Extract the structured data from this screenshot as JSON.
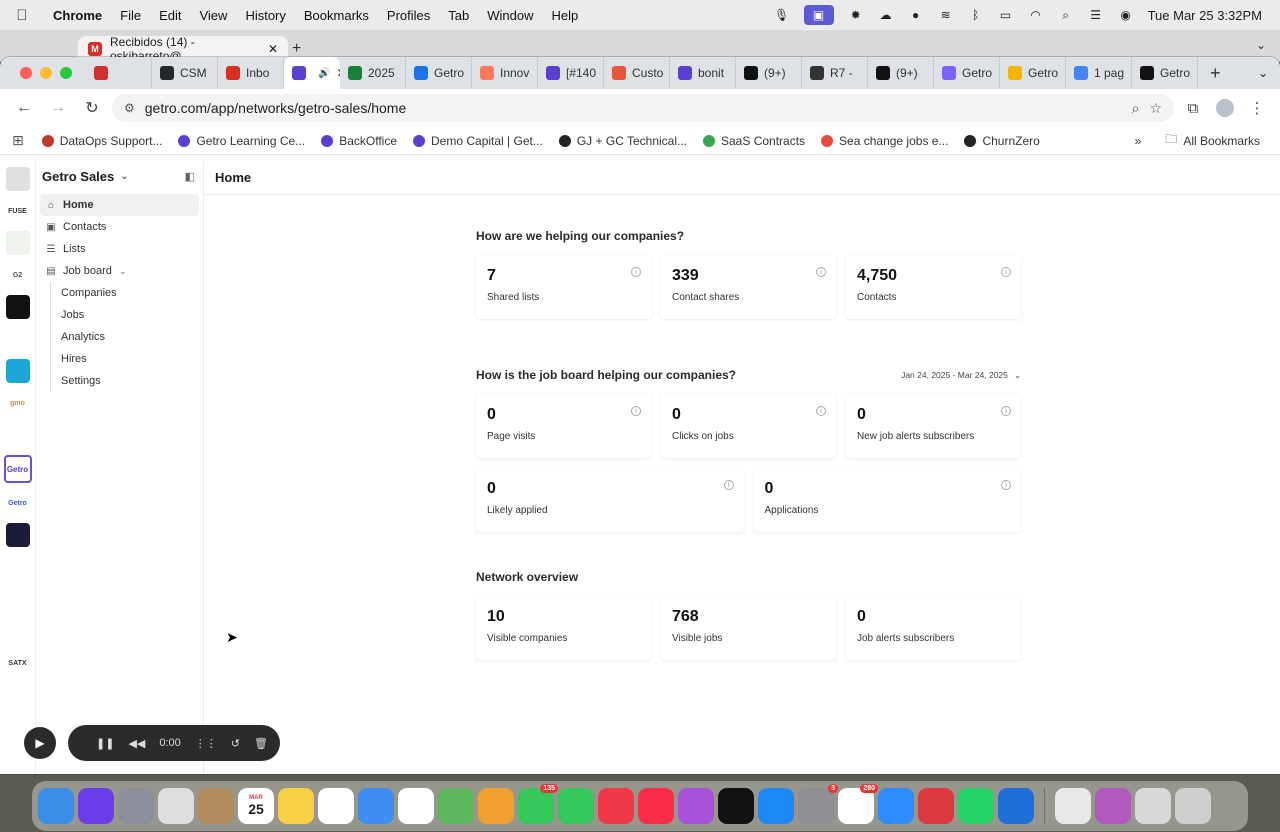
{
  "menubar": {
    "app": "Chrome",
    "items": [
      "File",
      "Edit",
      "View",
      "History",
      "Bookmarks",
      "Profiles",
      "Tab",
      "Window",
      "Help"
    ],
    "datetime": "Tue Mar 25  3:32PM"
  },
  "ghost_window": {
    "tab_title": "Recibidos (14) - oskibarreto@"
  },
  "browser": {
    "tabs": [
      {
        "label": "",
        "icon": "record-icon",
        "color": "#d32f2f"
      },
      {
        "label": "CSM",
        "icon": "github-icon",
        "color": "#24292e"
      },
      {
        "label": "Inbo",
        "icon": "gmail-icon",
        "color": "#d93025"
      },
      {
        "label": "",
        "icon": "getro-icon",
        "color": "#5b3fd0",
        "active": true
      },
      {
        "label": "2025",
        "icon": "sheets-icon",
        "color": "#188038"
      },
      {
        "label": "Getro",
        "icon": "calendar-icon",
        "color": "#1a73e8"
      },
      {
        "label": "Innov",
        "icon": "hubspot-icon",
        "color": "#ff7a59"
      },
      {
        "label": "[#140",
        "icon": "getro-icon",
        "color": "#5b3fd0"
      },
      {
        "label": "Custo",
        "icon": "zendesk-icon",
        "color": "#e8553a"
      },
      {
        "label": "bonit",
        "icon": "getro-icon",
        "color": "#5b3fd0"
      },
      {
        "label": "(9+)",
        "icon": "notion-icon",
        "color": "#111111"
      },
      {
        "label": "R7 -",
        "icon": "link-icon",
        "color": "#333333"
      },
      {
        "label": "(9+)",
        "icon": "notion-icon",
        "color": "#111111"
      },
      {
        "label": "Getro",
        "icon": "gear-icon",
        "color": "#7b61ff"
      },
      {
        "label": "Getro",
        "icon": "slides-icon",
        "color": "#f4b400"
      },
      {
        "label": "1 pag",
        "icon": "docs-icon",
        "color": "#4285f4"
      },
      {
        "label": "Getro",
        "icon": "getro-logo-icon",
        "color": "#111111"
      }
    ],
    "url": "getro.com/app/networks/getro-sales/home",
    "bookmarks": [
      {
        "label": "DataOps Support...",
        "color": "#c0392b"
      },
      {
        "label": "Getro Learning Ce...",
        "color": "#5b3fd0"
      },
      {
        "label": "BackOffice",
        "color": "#5b3fd0"
      },
      {
        "label": "Demo Capital | Get...",
        "color": "#5b3fd0"
      },
      {
        "label": "GJ + GC Technical...",
        "color": "#222222"
      },
      {
        "label": "SaaS Contracts",
        "color": "#34a853"
      },
      {
        "label": "Sea change jobs e...",
        "color": "#e74c3c"
      },
      {
        "label": "ChurnZero",
        "color": "#222222"
      }
    ],
    "all_bookmarks": "All Bookmarks"
  },
  "rail": {
    "items": [
      {
        "label": "",
        "color": "#e0e0e0",
        "text_color": "#333333"
      },
      {
        "label": "FUSE",
        "color": "#ffffff",
        "text_color": "#333333"
      },
      {
        "label": "",
        "color": "#eef3ee",
        "text_color": "#333333"
      },
      {
        "label": "G2",
        "color": "#ffffff",
        "text_color": "#555555"
      },
      {
        "label": "",
        "color": "#111111",
        "text_color": "#ffffff"
      },
      {
        "label": "",
        "color": "#ffffff",
        "text_color": "#c08a20"
      },
      {
        "label": "",
        "color": "#1aa6d6",
        "text_color": "#ffffff"
      },
      {
        "label": "gmo",
        "color": "#ffffff",
        "text_color": "#e08a1a"
      },
      {
        "label": "",
        "color": "#ffffff",
        "text_color": "#5b3fd0"
      },
      {
        "label": "Getro",
        "color": "#ffffff",
        "text_color": "#5338c9",
        "selected": true
      },
      {
        "label": "Getro",
        "color": "#ffffff",
        "text_color": "#3a5bd0"
      },
      {
        "label": "",
        "color": "#1b1b3a",
        "text_color": "#ffffff"
      },
      {
        "label": "",
        "color": "#ffffff",
        "text_color": "#222222"
      },
      {
        "label": "",
        "color": "#ffffff",
        "text_color": "#999999"
      },
      {
        "label": "",
        "color": "#ffffff",
        "text_color": "#e08a1a"
      },
      {
        "label": "SATX",
        "color": "#ffffff",
        "text_color": "#333333"
      },
      {
        "label": "",
        "color": "#ffffff",
        "text_color": "#333333"
      }
    ]
  },
  "sidebar": {
    "workspace": "Getro Sales",
    "nav": [
      {
        "label": "Home",
        "icon": "home-icon",
        "active": true
      },
      {
        "label": "Contacts",
        "icon": "contacts-icon"
      },
      {
        "label": "Lists",
        "icon": "list-icon"
      },
      {
        "label": "Job board",
        "icon": "job-board-icon",
        "expanded": true
      }
    ],
    "sub_nav": [
      "Companies",
      "Jobs",
      "Analytics",
      "Hires",
      "Settings"
    ]
  },
  "page": {
    "title": "Home",
    "section1": {
      "title": "How are we helping our companies?",
      "cards": [
        {
          "value": "7",
          "label": "Shared lists"
        },
        {
          "value": "339",
          "label": "Contact shares"
        },
        {
          "value": "4,750",
          "label": "Contacts"
        }
      ]
    },
    "section2": {
      "title": "How is the job board helping our companies?",
      "date_range": "Jan 24, 2025 - Mar 24, 2025",
      "cards": [
        {
          "value": "0",
          "label": "Page visits"
        },
        {
          "value": "0",
          "label": "Clicks on jobs"
        },
        {
          "value": "0",
          "label": "New job alerts subscribers"
        }
      ],
      "cards_row2": [
        {
          "value": "0",
          "label": "Likely applied"
        },
        {
          "value": "0",
          "label": "Applications"
        }
      ]
    },
    "section3": {
      "title": "Network overview",
      "cards": [
        {
          "value": "10",
          "label": "Visible companies"
        },
        {
          "value": "768",
          "label": "Visible jobs"
        },
        {
          "value": "0",
          "label": "Job alerts subscribers"
        }
      ]
    }
  },
  "recorder": {
    "time": "0:00"
  },
  "dock": {
    "apps": [
      {
        "name": "finder-icon",
        "color": "#3b8ee8"
      },
      {
        "name": "siri-icon",
        "color": "#6a3de8"
      },
      {
        "name": "launchpad-icon",
        "color": "#8a8f9a"
      },
      {
        "name": "chrome-icon",
        "color": "#dddddd"
      },
      {
        "name": "tools-icon",
        "color": "#b08a5a"
      },
      {
        "name": "calendar-icon",
        "color": "#ffffff",
        "text": "25",
        "sub": "MAR"
      },
      {
        "name": "notes-icon",
        "color": "#f7d046"
      },
      {
        "name": "freeform-icon",
        "color": "#ffffff"
      },
      {
        "name": "mail-icon",
        "color": "#3d8ef0"
      },
      {
        "name": "reminders-icon",
        "color": "#ffffff"
      },
      {
        "name": "maps-icon",
        "color": "#5cb85c"
      },
      {
        "name": "photos-icon",
        "color": "#f0a030"
      },
      {
        "name": "messages-icon",
        "color": "#34c759",
        "badge": "135"
      },
      {
        "name": "facetime-icon",
        "color": "#34c759"
      },
      {
        "name": "news-icon",
        "color": "#f03a4a"
      },
      {
        "name": "music-icon",
        "color": "#fa2d48"
      },
      {
        "name": "podcasts-icon",
        "color": "#a651d8"
      },
      {
        "name": "tv-icon",
        "color": "#111111"
      },
      {
        "name": "appstore-icon",
        "color": "#1e88f5"
      },
      {
        "name": "settings-icon",
        "color": "#8e8e93",
        "badge": "3"
      },
      {
        "name": "slack-icon",
        "color": "#ffffff",
        "badge": "280"
      },
      {
        "name": "zoom-icon",
        "color": "#2d8cff"
      },
      {
        "name": "expressvpn-icon",
        "color": "#da3940"
      },
      {
        "name": "whatsapp-icon",
        "color": "#25d366"
      },
      {
        "name": "windsurf-icon",
        "color": "#1f6fd8"
      },
      {
        "name": "pdf-file-icon",
        "color": "#e8e8e8"
      },
      {
        "name": "folder-stack-icon",
        "color": "#b05ac0"
      },
      {
        "name": "downloads-icon",
        "color": "#d8d8d8"
      },
      {
        "name": "trash-icon",
        "color": "#cfcfcf"
      }
    ]
  }
}
